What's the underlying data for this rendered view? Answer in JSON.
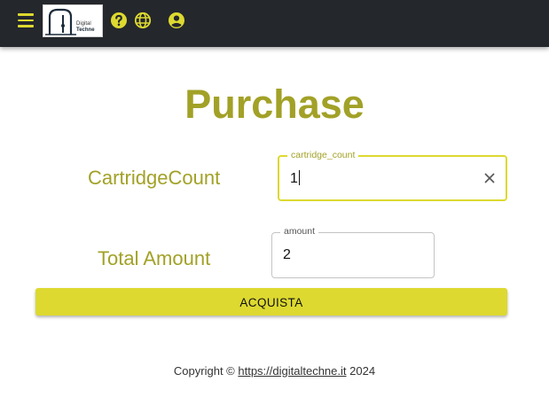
{
  "appbar": {
    "logo": {
      "line1": "Digital",
      "line2": "Techne"
    }
  },
  "page": {
    "title": "Purchase"
  },
  "form": {
    "cartridge": {
      "label": "CartridgeCount",
      "legend": "cartridge_count",
      "value": "1"
    },
    "amount": {
      "label": "Total Amount",
      "legend": "amount",
      "value": "2"
    },
    "buy_label": "ACQUISTA"
  },
  "footer": {
    "prefix": "Copyright © ",
    "link": "https://digitaltechne.it",
    "suffix": " 2024"
  },
  "colors": {
    "accent": "#ddd930",
    "title": "#a2a127",
    "appbar": "#24272c"
  },
  "icons": [
    "menu-icon",
    "help-icon",
    "globe-icon",
    "account-icon",
    "clear-icon"
  ]
}
